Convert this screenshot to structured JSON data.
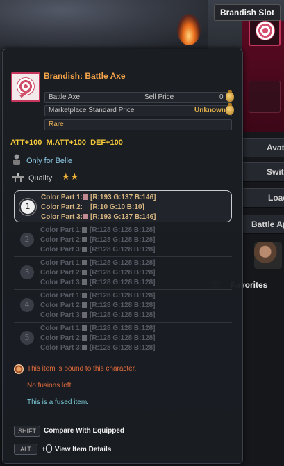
{
  "slot_tooltip": {
    "label": "Brandish Slot"
  },
  "side_menu": {
    "items": [
      {
        "label": "Avata"
      },
      {
        "label": "Switc"
      },
      {
        "label": "Load"
      },
      {
        "label": "Battle Ap"
      }
    ],
    "favorites_label": "Favorites"
  },
  "item": {
    "name": "Brandish: Battle Axe",
    "name_color": "#f4a44a",
    "row1": {
      "left": "Battle Axe",
      "right_label": "Sell Price",
      "right_value": "0"
    },
    "row2": {
      "left": "Marketplace Standard Price",
      "right_value": "Unknown"
    },
    "row3": {
      "left": "Rare"
    },
    "stats": "ATT+100  M.ATT+100  DEF+100",
    "restriction": "Only for Belle",
    "quality_label": "Quality",
    "quality_stars": "★★"
  },
  "color_sets": [
    {
      "num": "1",
      "active": true,
      "parts": [
        {
          "label": "Color Part 1:",
          "value": "[R:193 G:137 B:146]",
          "swatch": "#c18992"
        },
        {
          "label": "Color Part 2:",
          "value": "[R:10 G:10 B:10]",
          "swatch": ""
        },
        {
          "label": "Color Part 3:",
          "value": "[R:193 G:137 B:146]",
          "swatch": "#c18992"
        }
      ]
    },
    {
      "num": "2",
      "active": false,
      "parts": [
        {
          "label": "Color Part 1:",
          "value": "[R:128 G:128 B:128]",
          "swatch": "#808080"
        },
        {
          "label": "Color Part 2:",
          "value": "[R:128 G:128 B:128]",
          "swatch": "#808080"
        },
        {
          "label": "Color Part 3:",
          "value": "[R:128 G:128 B:128]",
          "swatch": "#808080"
        }
      ]
    },
    {
      "num": "3",
      "active": false,
      "parts": [
        {
          "label": "Color Part 1:",
          "value": "[R:128 G:128 B:128]",
          "swatch": "#808080"
        },
        {
          "label": "Color Part 2:",
          "value": "[R:128 G:128 B:128]",
          "swatch": "#808080"
        },
        {
          "label": "Color Part 3:",
          "value": "[R:128 G:128 B:128]",
          "swatch": "#808080"
        }
      ]
    },
    {
      "num": "4",
      "active": false,
      "parts": [
        {
          "label": "Color Part 1:",
          "value": "[R:128 G:128 B:128]",
          "swatch": "#808080"
        },
        {
          "label": "Color Part 2:",
          "value": "[R:128 G:128 B:128]",
          "swatch": "#808080"
        },
        {
          "label": "Color Part 3:",
          "value": "[R:128 G:128 B:128]",
          "swatch": "#808080"
        }
      ]
    },
    {
      "num": "5",
      "active": false,
      "parts": [
        {
          "label": "Color Part 1:",
          "value": "[R:128 G:128 B:128]",
          "swatch": "#808080"
        },
        {
          "label": "Color Part 2:",
          "value": "[R:128 G:128 B:128]",
          "swatch": "#808080"
        },
        {
          "label": "Color Part 3:",
          "value": "[R:128 G:128 B:128]",
          "swatch": "#808080"
        }
      ]
    }
  ],
  "notes": {
    "bound": "This item is bound to this character.",
    "fusions": "No fusions left.",
    "fused": "This is a fused item."
  },
  "hotkeys": {
    "shift_key": "SHIFT",
    "shift_label": "Compare With Equipped",
    "alt_key": "ALT",
    "alt_plus": "+",
    "alt_label": "View Item Details"
  },
  "icons": [
    "target-item-icon",
    "eye-icon",
    "coin-icon",
    "character-icon",
    "quality-icon",
    "bound-icon",
    "mouse-icon",
    "star-icon"
  ]
}
